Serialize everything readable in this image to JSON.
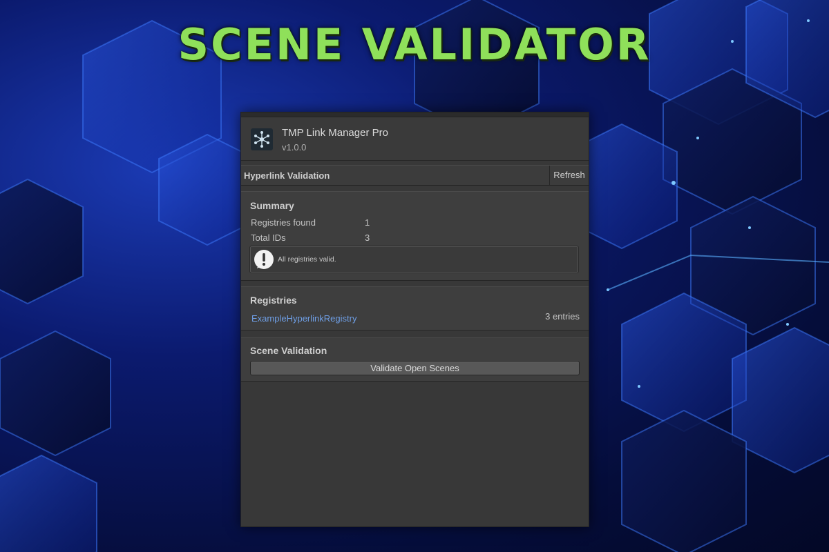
{
  "banner": {
    "title": "SCENE VALIDATOR"
  },
  "colors": {
    "accent_green": "#8fe05a",
    "link_blue": "#6f9fe6",
    "panel_bg": "#383838"
  },
  "window": {
    "logo_icon": "network-nodes-icon",
    "app_name": "TMP Link Manager Pro",
    "version": "v1.0.0"
  },
  "toolbar": {
    "title": "Hyperlink Validation",
    "refresh_label": "Refresh"
  },
  "summary": {
    "title": "Summary",
    "rows": [
      {
        "label": "Registries found",
        "value": "1"
      },
      {
        "label": "Total IDs",
        "value": "3"
      }
    ],
    "info_icon": "info-exclamation-icon",
    "message": "All registries valid."
  },
  "registries": {
    "title": "Registries",
    "items": [
      {
        "name": "ExampleHyperlinkRegistry",
        "count": "3 entries"
      }
    ]
  },
  "scene_validation": {
    "title": "Scene Validation",
    "button_label": "Validate Open Scenes"
  }
}
